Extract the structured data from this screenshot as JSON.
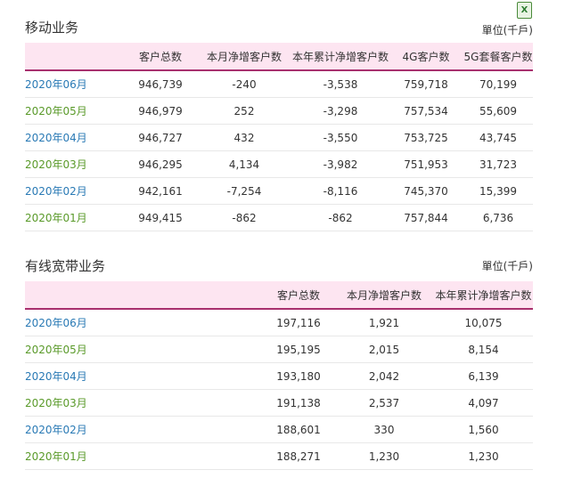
{
  "mobile": {
    "title": "移动业务",
    "unit": "單位(千戶)",
    "export_icon": "excel-icon",
    "export_label": "X",
    "headers": [
      "",
      "客户总数",
      "本月净增客户数",
      "本年累计净增客户数",
      "4G客户数",
      "5G套餐客户数"
    ],
    "rows": [
      [
        "2020年06月",
        "946,739",
        "-240",
        "-3,538",
        "759,718",
        "70,199"
      ],
      [
        "2020年05月",
        "946,979",
        "252",
        "-3,298",
        "757,534",
        "55,609"
      ],
      [
        "2020年04月",
        "946,727",
        "432",
        "-3,550",
        "753,725",
        "43,745"
      ],
      [
        "2020年03月",
        "946,295",
        "4,134",
        "-3,982",
        "751,953",
        "31,723"
      ],
      [
        "2020年02月",
        "942,161",
        "-7,254",
        "-8,116",
        "745,370",
        "15,399"
      ],
      [
        "2020年01月",
        "949,415",
        "-862",
        "-862",
        "757,844",
        "6,736"
      ]
    ]
  },
  "broadband": {
    "title": "有线宽带业务",
    "unit": "單位(千戶)",
    "headers": [
      "",
      "客户总数",
      "本月净增客户数",
      "本年累计净增客户数"
    ],
    "rows": [
      [
        "2020年06月",
        "197,116",
        "1,921",
        "10,075"
      ],
      [
        "2020年05月",
        "195,195",
        "2,015",
        "8,154"
      ],
      [
        "2020年04月",
        "193,180",
        "2,042",
        "6,139"
      ],
      [
        "2020年03月",
        "191,138",
        "2,537",
        "4,097"
      ],
      [
        "2020年02月",
        "188,601",
        "330",
        "1,560"
      ],
      [
        "2020年01月",
        "188,271",
        "1,230",
        "1,230"
      ]
    ]
  },
  "colors": {
    "date_blue": "#2a7ab5",
    "date_green": "#5a9a2a",
    "header_bg": "#fde5f1",
    "header_border": "#a8306e"
  }
}
